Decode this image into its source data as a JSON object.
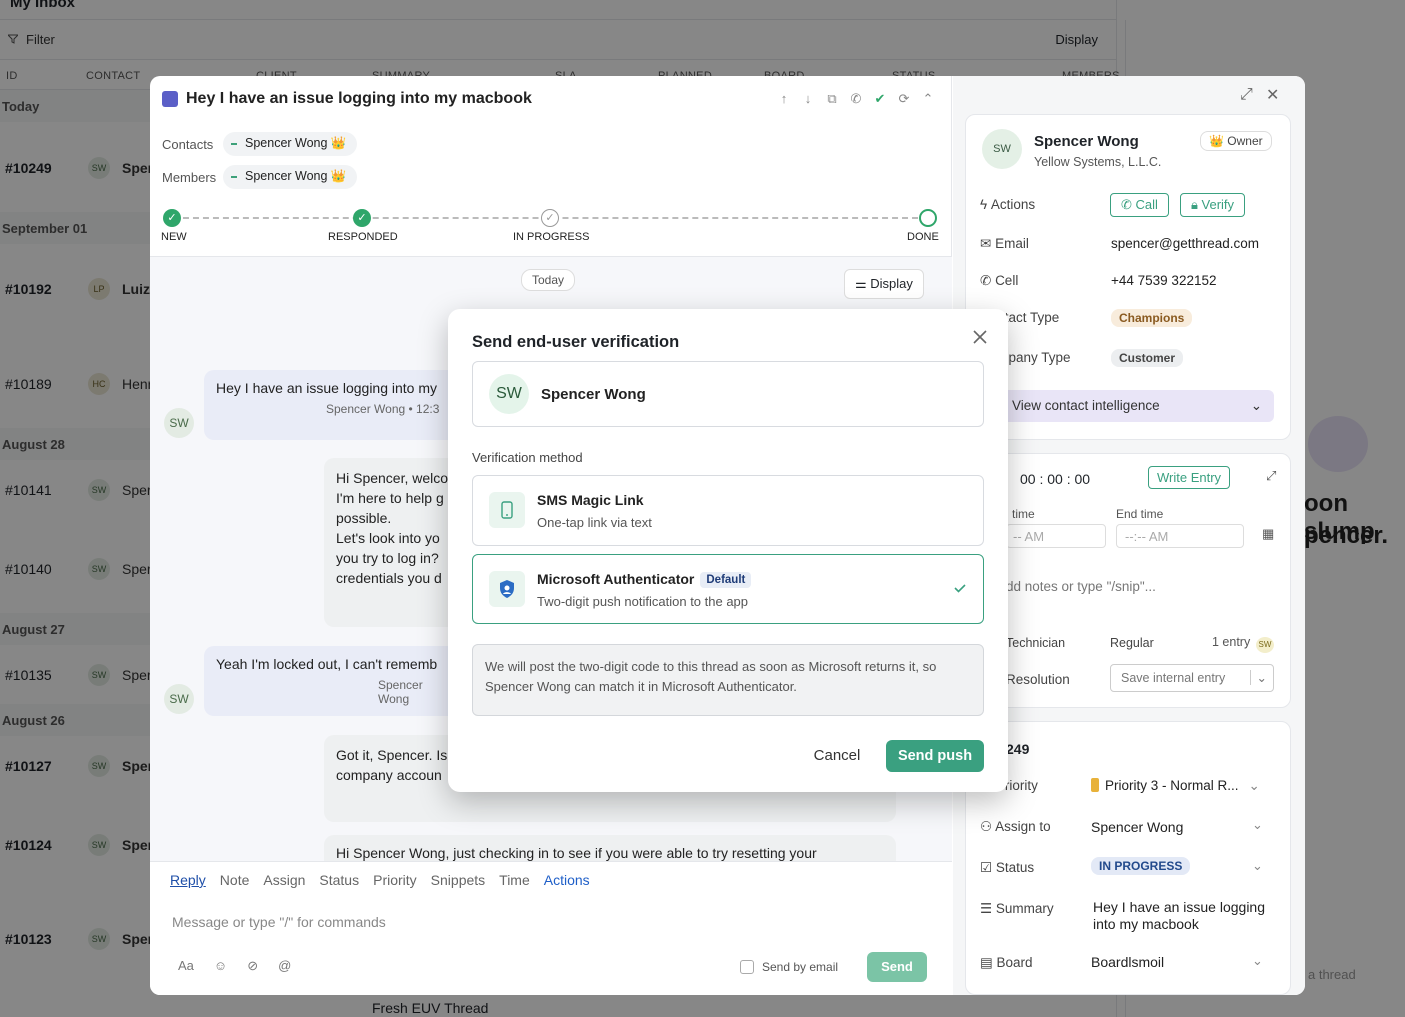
{
  "inbox": {
    "title": "My Inbox",
    "filter_label": "Filter",
    "display_label": "Display",
    "columns": [
      "ID",
      "CONTACT",
      "CLIENT",
      "SUMMARY",
      "SLA",
      "PLANNED",
      "BOARD",
      "STATUS",
      "MEMBERS"
    ],
    "sections": [
      "Today",
      "September 01",
      "August 28",
      "August 27",
      "August 26"
    ],
    "rows": [
      {
        "id": "#10249",
        "initials": "SW",
        "name": "Sper"
      },
      {
        "id": "#10192",
        "initials": "LP",
        "name": "Luiz"
      },
      {
        "id": "#10189",
        "initials": "HC",
        "name": "Henr"
      },
      {
        "id": "#10141",
        "initials": "SW",
        "name": "Sper"
      },
      {
        "id": "#10140",
        "initials": "SW",
        "name": "Sper"
      },
      {
        "id": "#10135",
        "initials": "SW",
        "name": "Sper"
      },
      {
        "id": "#10127",
        "initials": "SW",
        "name": "Sper"
      },
      {
        "id": "#10124",
        "initials": "SW",
        "name": "Sper"
      },
      {
        "id": "#10123",
        "initials": "SW",
        "name": "Sper"
      }
    ],
    "bottom_row_summary": "Fresh EUV Thread"
  },
  "ticket": {
    "title": "Hey I have an issue logging into my macbook",
    "contacts_label": "Contacts",
    "members_label": "Members",
    "contact_name": "Spencer Wong 👑",
    "member_name": "Spencer Wong 👑",
    "stages": [
      "NEW",
      "RESPONDED",
      "IN PROGRESS",
      "DONE"
    ],
    "today_pill": "Today",
    "display_label": "Display",
    "messages": [
      {
        "text": "Hey I have an issue logging into my",
        "meta": "Spencer Wong • 12:3"
      },
      {
        "text": "Hi Spencer, welco\nI'm here to help g\npossible.\nLet's look into yo\nyou try to log in?\ncredentials you d"
      },
      {
        "text": "Yeah I'm locked out, I can't rememb",
        "meta": "Spencer Wong"
      },
      {
        "text": "Got it, Spencer. Is\ncompany accoun"
      },
      {
        "text": "Hi Spencer Wong, just checking in to see if you were able to try resetting your"
      }
    ],
    "composer_tabs": [
      "Reply",
      "Note",
      "Assign",
      "Status",
      "Priority",
      "Snippets",
      "Time",
      "Actions"
    ],
    "composer_placeholder": "Message or type \"/\" for commands",
    "send_by_email": "Send by email",
    "send_label": "Send"
  },
  "contact_card": {
    "initials": "SW",
    "name": "Spencer Wong",
    "company": "Yellow Systems, L.L.C.",
    "role_badge": "👑 Owner",
    "actions_label": "Actions",
    "call_label": "Call",
    "verify_label": "Verify",
    "email_label": "Email",
    "email": "spencer@getthread.com",
    "cell_label": "Cell",
    "cell": "+44 7539 322152",
    "contact_type_label": "Contact Type",
    "contact_type": "Champions",
    "company_type_label": "Company Type",
    "company_type": "Customer",
    "intel_label": "View contact intelligence"
  },
  "time_card": {
    "timer": "00 : 00 : 00",
    "write_entry": "Write Entry",
    "start_label": "time",
    "end_label": "End time",
    "start_placeholder": "-- AM",
    "end_placeholder": "--:-- AM",
    "notes_placeholder": "dd notes or type \"/snip\"...",
    "technician_label": "Technician",
    "work_type": "Regular",
    "entries": "1 entry",
    "entries_initials": "SW",
    "resolution_label": "Resolution",
    "save_entry": "Save internal entry"
  },
  "details_card": {
    "id": "249",
    "priority_label": "Priority",
    "priority": "Priority 3 - Normal R...",
    "assign_label": "Assign to",
    "assignee": "Spencer Wong",
    "status_label": "Status",
    "status": "IN PROGRESS",
    "summary_label": "Summary",
    "summary": "Hey I have an issue logging into my macbook",
    "board_label": "Board",
    "board": "Boardlsmoil"
  },
  "side_partial": {
    "text1": "oon slump",
    "text2": "pencer.",
    "thread_placeholder": "a thread"
  },
  "modal": {
    "title": "Send end-user verification",
    "recipient_initials": "SW",
    "recipient_name": "Spencer Wong",
    "method_label": "Verification method",
    "options": [
      {
        "title": "SMS Magic Link",
        "subtitle": "One-tap link via text",
        "icon": "phone-icon"
      },
      {
        "title": "Microsoft Authenticator",
        "badge": "Default",
        "subtitle": "Two-digit push notification to the app",
        "icon": "authenticator-icon",
        "selected": true
      }
    ],
    "note": "We will post the two-digit code to this thread as soon as Microsoft returns it, so Spencer Wong can match it in Microsoft Authenticator.",
    "cancel_label": "Cancel",
    "send_label": "Send push",
    "accent": "#3aa080"
  }
}
